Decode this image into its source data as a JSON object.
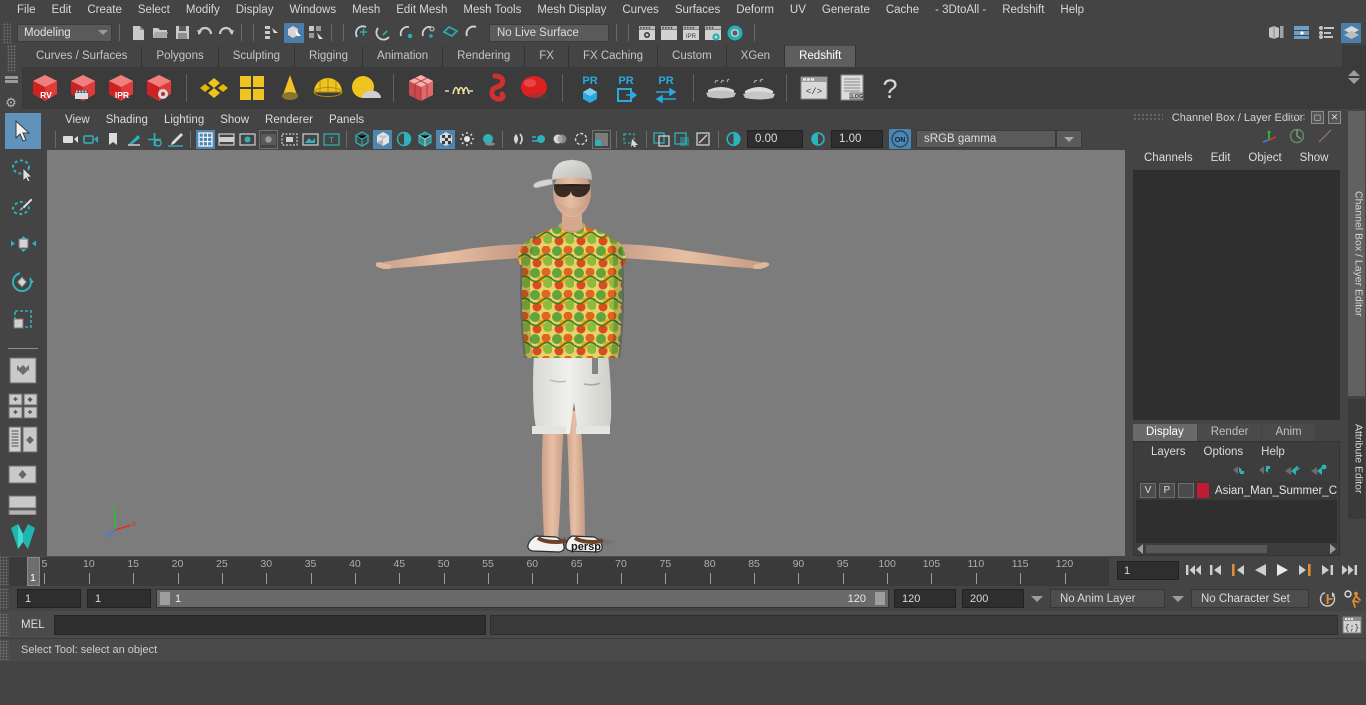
{
  "app": {
    "title": "Autodesk Maya"
  },
  "menubar": {
    "items": [
      "File",
      "Edit",
      "Create",
      "Select",
      "Modify",
      "Display",
      "Windows",
      "Mesh",
      "Edit Mesh",
      "Mesh Tools",
      "Mesh Display",
      "Curves",
      "Surfaces",
      "Deform",
      "UV",
      "Generate",
      "Cache",
      "- 3DtoAll -",
      "Redshift",
      "Help"
    ]
  },
  "statusline": {
    "mode_selector": {
      "value": "Modeling"
    },
    "live_surface": {
      "value": "No Live Surface"
    },
    "icons": [
      "new-scene-icon",
      "open-scene-icon",
      "save-scene-icon",
      "undo-icon",
      "redo-icon",
      "select-by-hierarchy-icon",
      "select-by-object-icon",
      "select-by-component-icon",
      "snap-to-grid-icon",
      "snap-to-curve-icon",
      "snap-to-point-icon",
      "snap-to-projected-center-icon",
      "snap-to-view-plane-icon",
      "make-live-icon",
      "render-view-icon",
      "render-sequence-icon",
      "ipr-render-icon",
      "render-settings-icon",
      "hypershade-icon"
    ],
    "right_icons": [
      "show-hide-modeling-toolkit-icon",
      "show-hide-attribute-editor-icon",
      "show-hide-tool-settings-icon",
      "show-hide-channel-box-icon"
    ]
  },
  "shelf": {
    "tabs": [
      "Curves / Surfaces",
      "Polygons",
      "Sculpting",
      "Rigging",
      "Animation",
      "Rendering",
      "FX",
      "FX Caching",
      "Custom",
      "XGen",
      "Redshift"
    ],
    "active_tab": "Redshift",
    "buttons": [
      {
        "name": "redshift-render-view",
        "label": "RV"
      },
      {
        "name": "redshift-render-sequence",
        "label": ""
      },
      {
        "name": "redshift-ipr-render",
        "label": "IPR"
      },
      {
        "name": "redshift-render-settings",
        "label": ""
      },
      {
        "name": "redshift-material-diamond",
        "label": ""
      },
      {
        "name": "redshift-material-grid",
        "label": ""
      },
      {
        "name": "redshift-material-cone",
        "label": ""
      },
      {
        "name": "redshift-material-sphere",
        "label": ""
      },
      {
        "name": "redshift-material-dome",
        "label": ""
      },
      {
        "name": "redshift-proxy-cube",
        "label": ""
      },
      {
        "name": "redshift-motion-blur",
        "label": ""
      },
      {
        "name": "redshift-volume",
        "label": ""
      },
      {
        "name": "redshift-sphere-light",
        "label": ""
      },
      {
        "name": "redshift-pr-object",
        "label": "PR"
      },
      {
        "name": "redshift-pr-export",
        "label": "PR"
      },
      {
        "name": "redshift-pr-transfer",
        "label": "PR"
      },
      {
        "name": "redshift-bake-1",
        "label": ""
      },
      {
        "name": "redshift-bake-2",
        "label": ""
      },
      {
        "name": "redshift-script-editor",
        "label": ""
      },
      {
        "name": "redshift-log",
        "label": ".LOG"
      },
      {
        "name": "redshift-help",
        "label": "?"
      }
    ]
  },
  "toolbox": {
    "tools": [
      {
        "name": "select-tool",
        "selected": true
      },
      {
        "name": "lasso-select-tool",
        "selected": false
      },
      {
        "name": "paint-select-tool",
        "selected": false
      },
      {
        "name": "move-tool",
        "selected": false
      },
      {
        "name": "rotate-tool",
        "selected": false
      },
      {
        "name": "scale-tool",
        "selected": false
      }
    ],
    "layout_presets": [
      "single-perspective-view",
      "four-view-layout",
      "outliner-persp-layout",
      "hypergraph-persp-layout",
      "single-persp-bottom"
    ]
  },
  "viewport": {
    "menus": [
      "View",
      "Shading",
      "Lighting",
      "Show",
      "Renderer",
      "Panels"
    ],
    "camera_label": "persp",
    "exposure": "0.00",
    "gamma": "1.00",
    "color_management": "sRGB gamma",
    "gamma_toggle": "ON",
    "toolbar_icons": [
      "select-camera-icon",
      "camera-attributes-icon",
      "bookmark-icon",
      "image-plane-icon",
      "two-d-pan-zoom-icon",
      "grease-pencil-icon",
      "grid-toggle-icon",
      "film-gate-icon",
      "resolution-gate-icon",
      "gate-mask-icon",
      "film-origin-icon",
      "safe-action-icon",
      "field-chart-icon",
      "wireframe-icon",
      "smooth-shade-icon",
      "shade-all-icon",
      "wireframe-on-shaded-icon",
      "texture-toggle-icon",
      "lights-toggle-icon",
      "shadows-icon",
      "screen-space-ao-icon",
      "motion-blur-icon",
      "multisample-icon",
      "depth-of-field-icon",
      "viewport-renderer-icon",
      "isolate-select-icon",
      "xray-icon",
      "xray-joints-icon",
      "xray-active-components-icon",
      "exposure-icon",
      "gamma-icon",
      "color-management-icon"
    ]
  },
  "channel_box": {
    "title": "Channel Box / Layer Editor",
    "menus": [
      "Channels",
      "Edit",
      "Object",
      "Show"
    ],
    "icons": [
      "channel-box-icon",
      "attribute-editor-icon",
      "tool-settings-icon"
    ],
    "window_buttons": [
      "undock-icon",
      "close-icon"
    ],
    "vertical_tabs": [
      "Channel Box / Layer Editor",
      "Attribute Editor"
    ]
  },
  "layer_editor": {
    "tabs": [
      "Display",
      "Render",
      "Anim"
    ],
    "active_tab": "Display",
    "menus": [
      "Layers",
      "Options",
      "Help"
    ],
    "buttons": [
      "move-layer-up-icon",
      "move-layer-down-icon",
      "create-new-layer-icon",
      "create-layer-from-selected-icon"
    ],
    "layers": [
      {
        "visibility": "V",
        "playback": "P",
        "shading": "",
        "color": "#c01a37",
        "name": "Asian_Man_Summer_C"
      }
    ]
  },
  "timeline": {
    "ticks": [
      5,
      10,
      15,
      20,
      25,
      30,
      35,
      40,
      45,
      50,
      55,
      60,
      65,
      70,
      75,
      80,
      85,
      90,
      95,
      100,
      105,
      110,
      115,
      120
    ],
    "current_frame_marker": "1",
    "current_frame_field": "1",
    "playback_buttons": [
      "go-to-start-icon",
      "step-back-keyframe-icon",
      "step-back-frame-icon",
      "play-backwards-icon",
      "play-forwards-icon",
      "step-forward-frame-icon",
      "step-forward-keyframe-icon",
      "go-to-end-icon"
    ]
  },
  "range": {
    "anim_start": "1",
    "range_start": "1",
    "slider_min_label": "1",
    "slider_max_label": "120",
    "range_end": "120",
    "anim_end": "200",
    "anim_layer": "No Anim Layer",
    "character_set": "No Character Set",
    "icons": [
      "auto-keyframe-icon",
      "animation-preferences-icon"
    ]
  },
  "command_line": {
    "language_label": "MEL",
    "input_value": "",
    "output_value": "",
    "script_editor_icon": "script-editor-icon"
  },
  "help_line": {
    "text": "Select Tool: select an object"
  },
  "colors": {
    "window_bg": "#444444",
    "shelf_bg": "#3b3b3b",
    "viewport_bg": "#7c7c7c",
    "accent_blue": "#4f86b0",
    "accent_teal": "#20b2b8",
    "layer_color": "#c01a37",
    "panel_dark": "#2f2f2f"
  }
}
